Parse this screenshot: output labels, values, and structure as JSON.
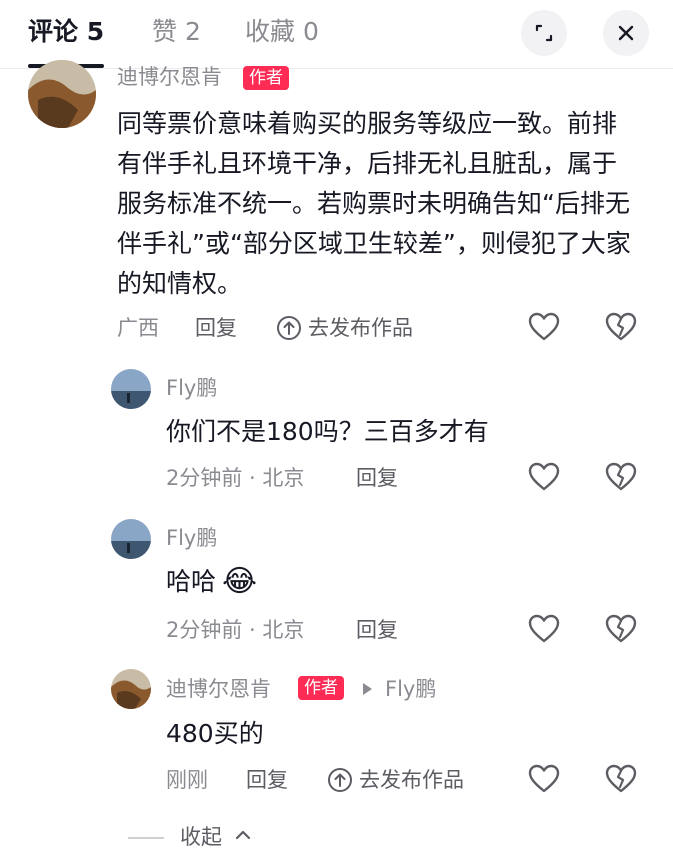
{
  "tabs": [
    {
      "label": "评论 5"
    },
    {
      "label": "赞 2"
    },
    {
      "label": "收藏 0"
    }
  ],
  "comments": [
    {
      "author": "迪博尔恩肯",
      "badge": "作者",
      "text": "同等票价意味着购买的服务等级应一致。前排有伴手礼且环境干净，后排无礼且脏乱，属于服务标准不统一。若购票时未明确告知“后排无伴手礼”或“部分区域卫生较差”，则侵犯了大家的知情权。",
      "location": "广西",
      "reply_label": "回复",
      "publish_label": "去发布作品"
    },
    {
      "author": "Fly鹏",
      "text": "你们不是180吗？三百多才有",
      "time_location": "2分钟前 · 北京",
      "reply_label": "回复"
    },
    {
      "author": "Fly鹏",
      "text": "哈哈",
      "emoji": "😂",
      "time_location": "2分钟前 · 北京",
      "reply_label": "回复"
    },
    {
      "author": "迪博尔恩肯",
      "badge": "作者",
      "reply_to": "Fly鹏",
      "text": "480买的",
      "time": "刚刚",
      "reply_label": "回复",
      "publish_label": "去发布作品"
    }
  ],
  "collapse_label": "收起",
  "colors": {
    "badge": "#fe2c55",
    "text": "#161823",
    "secondary": "#8a8b91"
  }
}
